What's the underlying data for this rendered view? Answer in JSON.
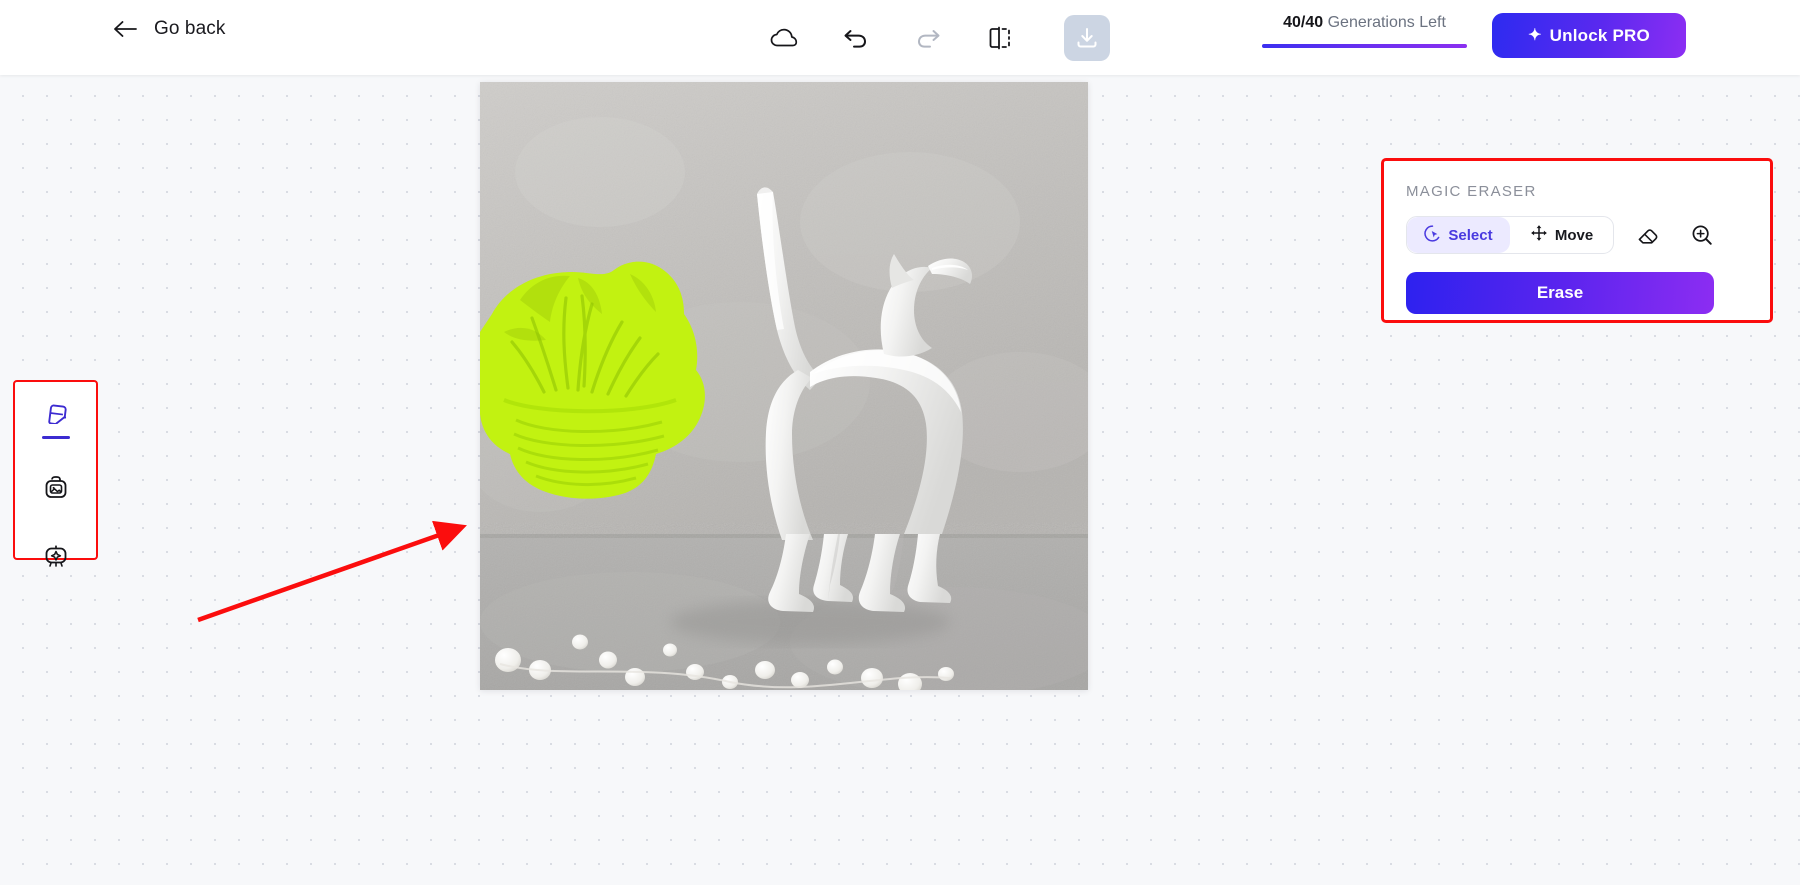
{
  "header": {
    "back_label": "Go back",
    "back_icon": "arrow-left-icon",
    "tools": [
      {
        "name": "cloud-icon",
        "label": "Cloud",
        "state": "enabled"
      },
      {
        "name": "undo-icon",
        "label": "Undo",
        "state": "enabled"
      },
      {
        "name": "redo-icon",
        "label": "Redo",
        "state": "disabled"
      },
      {
        "name": "compare-icon",
        "label": "Compare",
        "state": "enabled"
      },
      {
        "name": "download-icon",
        "label": "Download",
        "state": "enabled"
      }
    ],
    "generations": {
      "count": "40/40",
      "label": "Generations Left",
      "progress_percent": 100,
      "bar_color": "#3b2ff0"
    },
    "unlock_pro": {
      "label": "Unlock PRO",
      "icon": "sparkle-icon",
      "gradient_from": "#2d2bf0",
      "gradient_to": "#8c2ef3"
    }
  },
  "sidebar": {
    "highlight_color": "#fb0d0d",
    "items": [
      {
        "name": "sidebar-item-eraser",
        "icon": "eraser-icon",
        "label": "Magic Eraser",
        "active": true
      },
      {
        "name": "sidebar-item-background",
        "icon": "image-bag-icon",
        "label": "Background",
        "active": false
      },
      {
        "name": "sidebar-item-enhance",
        "icon": "magic-enhance-icon",
        "label": "Enhance",
        "active": false
      }
    ]
  },
  "canvas": {
    "background_color": "#f7f8fa",
    "dot_color": "#d9dce3",
    "image": {
      "alt": "White ceramic cat figurine beside a potted plant on gray carpet with pearls",
      "selection_mask_color": "#c2f211",
      "selection_target": "potted-plant"
    },
    "annotation": {
      "type": "arrow",
      "color": "#fb0d0d",
      "points": "from bottom-left canvas toward the selected plant"
    }
  },
  "magic_eraser": {
    "title": "MAGIC ERASER",
    "highlight_color": "#fb0d0d",
    "mode_options": [
      {
        "name": "mode-select",
        "label": "Select",
        "icon": "cursor-circle-icon",
        "active": true
      },
      {
        "name": "mode-move",
        "label": "Move",
        "icon": "move-arrows-icon",
        "active": false
      }
    ],
    "tool_icons": [
      {
        "name": "eraser-tool-icon",
        "label": "Eraser"
      },
      {
        "name": "zoom-in-icon",
        "label": "Zoom in"
      }
    ],
    "primary_action": {
      "label": "Erase",
      "gradient_from": "#2d22ef",
      "gradient_to": "#8c2df2"
    }
  }
}
